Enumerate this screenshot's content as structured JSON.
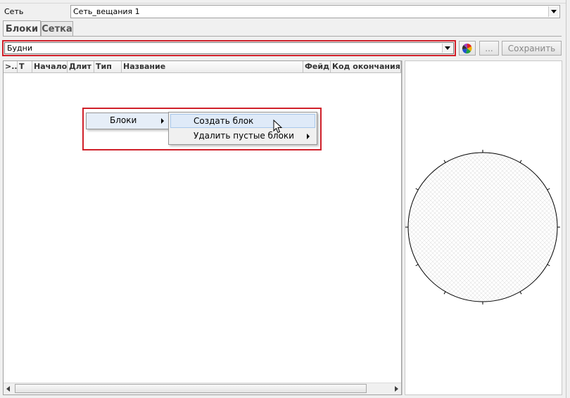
{
  "network": {
    "label": "Сеть",
    "value": "Сеть_вещания 1"
  },
  "tabs": [
    {
      "label": "Блоки",
      "active": true
    },
    {
      "label": "Сетка",
      "active": false
    }
  ],
  "schedule": {
    "value": "Будни"
  },
  "toolbar": {
    "color_icon": "color-wheel-icon",
    "browse_label": "...",
    "save_label": "Сохранить"
  },
  "grid": {
    "columns": [
      ">...",
      "Т",
      "Начало",
      "Длит",
      "Тип",
      "Название",
      "Фейд",
      "Код окончания"
    ]
  },
  "context_menu": {
    "item": "Блоки",
    "submenu": [
      "Создать блок",
      "Удалить пустые блоки"
    ]
  },
  "colors": {
    "highlight": "#d0202a",
    "menu_hover": "#dfeaf8"
  }
}
